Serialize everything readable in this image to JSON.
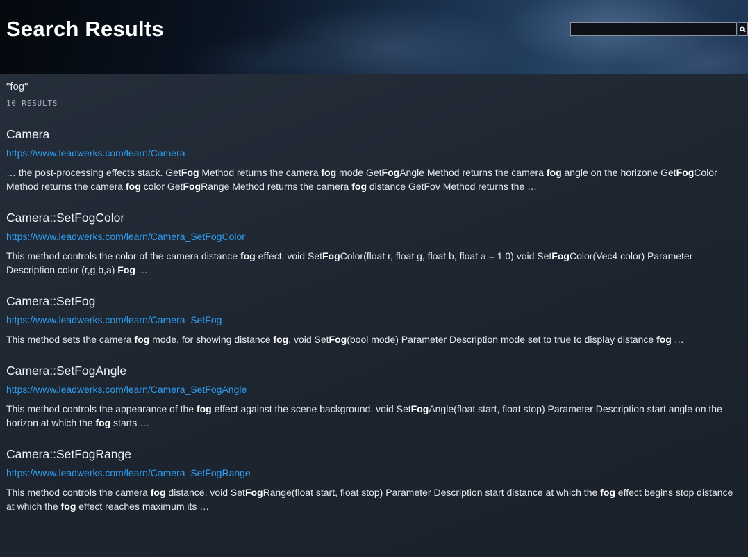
{
  "header": {
    "title": "Search Results",
    "search": {
      "value": "",
      "placeholder": "",
      "button_icon": "magnifier-icon"
    }
  },
  "query_display": "\"fog\"",
  "results_count": "10 RESULTS",
  "colors": {
    "accent": "#2e9ef0",
    "header_border": "#2f7fd0",
    "background": "#1d2530"
  },
  "results": [
    {
      "title": "Camera",
      "url": "https://www.leadwerks.com/learn/Camera",
      "snippet": [
        {
          "t": "… the post-processing effects stack. Get"
        },
        {
          "t": "Fog",
          "b": true
        },
        {
          "t": " Method returns the camera "
        },
        {
          "t": "fog",
          "b": true
        },
        {
          "t": " mode Get"
        },
        {
          "t": "Fog",
          "b": true
        },
        {
          "t": "Angle Method returns the camera "
        },
        {
          "t": "fog",
          "b": true
        },
        {
          "t": " angle on the horizone Get"
        },
        {
          "t": "Fog",
          "b": true
        },
        {
          "t": "Color Method returns the camera "
        },
        {
          "t": "fog",
          "b": true
        },
        {
          "t": " color Get"
        },
        {
          "t": "Fog",
          "b": true
        },
        {
          "t": "Range Method returns the camera "
        },
        {
          "t": "fog",
          "b": true
        },
        {
          "t": " distance GetFov Method returns the …"
        }
      ]
    },
    {
      "title": "Camera::SetFogColor",
      "url": "https://www.leadwerks.com/learn/Camera_SetFogColor",
      "snippet": [
        {
          "t": "This method controls the color of the camera distance "
        },
        {
          "t": "fog",
          "b": true
        },
        {
          "t": " effect. void Set"
        },
        {
          "t": "Fog",
          "b": true
        },
        {
          "t": "Color(float r, float g, float b, float a = 1.0) void Set"
        },
        {
          "t": "Fog",
          "b": true
        },
        {
          "t": "Color(Vec4 color) Parameter Description color (r,g,b,a) "
        },
        {
          "t": "Fog",
          "b": true
        },
        {
          "t": " …"
        }
      ]
    },
    {
      "title": "Camera::SetFog",
      "url": "https://www.leadwerks.com/learn/Camera_SetFog",
      "snippet": [
        {
          "t": "This method sets the camera "
        },
        {
          "t": "fog",
          "b": true
        },
        {
          "t": " mode, for showing distance "
        },
        {
          "t": "fog",
          "b": true
        },
        {
          "t": ". void Set"
        },
        {
          "t": "Fog",
          "b": true
        },
        {
          "t": "(bool mode) Parameter Description mode set to true to display distance "
        },
        {
          "t": "fog",
          "b": true
        },
        {
          "t": " …"
        }
      ]
    },
    {
      "title": "Camera::SetFogAngle",
      "url": "https://www.leadwerks.com/learn/Camera_SetFogAngle",
      "snippet": [
        {
          "t": "This method controls the appearance of the "
        },
        {
          "t": "fog",
          "b": true
        },
        {
          "t": " effect against the scene background. void Set"
        },
        {
          "t": "Fog",
          "b": true
        },
        {
          "t": "Angle(float start, float stop) Parameter Description start angle on the horizon at which the "
        },
        {
          "t": "fog",
          "b": true
        },
        {
          "t": " starts …"
        }
      ]
    },
    {
      "title": "Camera::SetFogRange",
      "url": "https://www.leadwerks.com/learn/Camera_SetFogRange",
      "snippet": [
        {
          "t": "This method controls the camera "
        },
        {
          "t": "fog",
          "b": true
        },
        {
          "t": " distance. void Set"
        },
        {
          "t": "Fog",
          "b": true
        },
        {
          "t": "Range(float start, float stop) Parameter Description start distance at which the "
        },
        {
          "t": "fog",
          "b": true
        },
        {
          "t": " effect begins stop distance at which the "
        },
        {
          "t": "fog",
          "b": true
        },
        {
          "t": " effect reaches maximum its …"
        }
      ]
    }
  ]
}
